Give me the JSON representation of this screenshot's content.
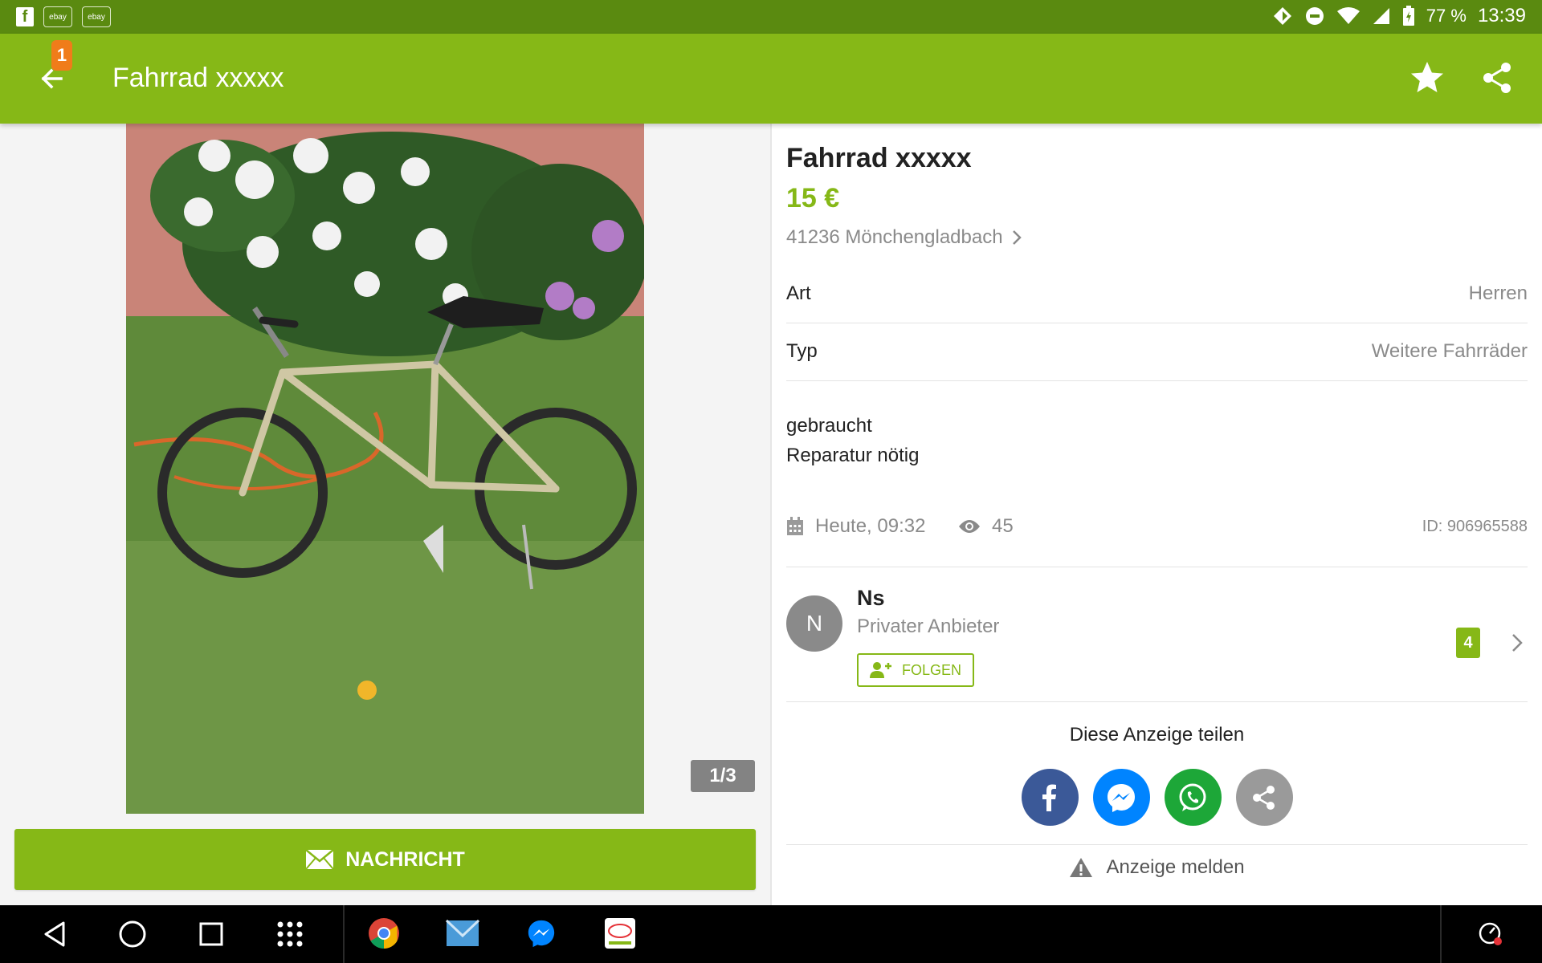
{
  "status_bar": {
    "left_icons": [
      "facebook-icon",
      "ebay-kleinanzeigen-icon",
      "ebay-kleinanzeigen-icon"
    ],
    "battery": "77 %",
    "time": "13:39"
  },
  "app_bar": {
    "notification_count": "1",
    "title": "Fahrrad xxxxx"
  },
  "gallery": {
    "counter": "1/3"
  },
  "message_button": {
    "label": "NACHRICHT"
  },
  "ad": {
    "title": "Fahrrad xxxxx",
    "price": "15 €",
    "location": "41236 Mönchengladbach",
    "attributes": [
      {
        "key": "Art",
        "value": "Herren"
      },
      {
        "key": "Typ",
        "value": "Weitere Fahrräder"
      }
    ],
    "description": [
      "gebraucht",
      "Reparatur nötig"
    ],
    "date": "Heute, 09:32",
    "views": "45",
    "id": "ID: 906965588"
  },
  "seller": {
    "initial": "N",
    "name": "Ns",
    "type": "Privater Anbieter",
    "follow_label": "FOLGEN",
    "rating_count": "4"
  },
  "share": {
    "title": "Diese Anzeige teilen",
    "buttons": [
      {
        "icon": "facebook-icon",
        "color": "#3b5998"
      },
      {
        "icon": "messenger-icon",
        "color": "#0084ff"
      },
      {
        "icon": "whatsapp-icon",
        "color": "#1da738"
      },
      {
        "icon": "share-icon",
        "color": "#9a9a9a"
      }
    ]
  },
  "report": {
    "label": "Anzeige melden"
  },
  "nav_bar": {
    "buttons": [
      "back-icon",
      "home-icon",
      "recents-icon",
      "apps-grid-icon"
    ],
    "apps": [
      "chrome-icon",
      "email-icon",
      "messenger-icon",
      "ebay-kleinanzeigen-icon"
    ]
  },
  "colors": {
    "accent": "#86b817",
    "status_bar": "#5a8a10",
    "badge": "#f07c1a"
  }
}
